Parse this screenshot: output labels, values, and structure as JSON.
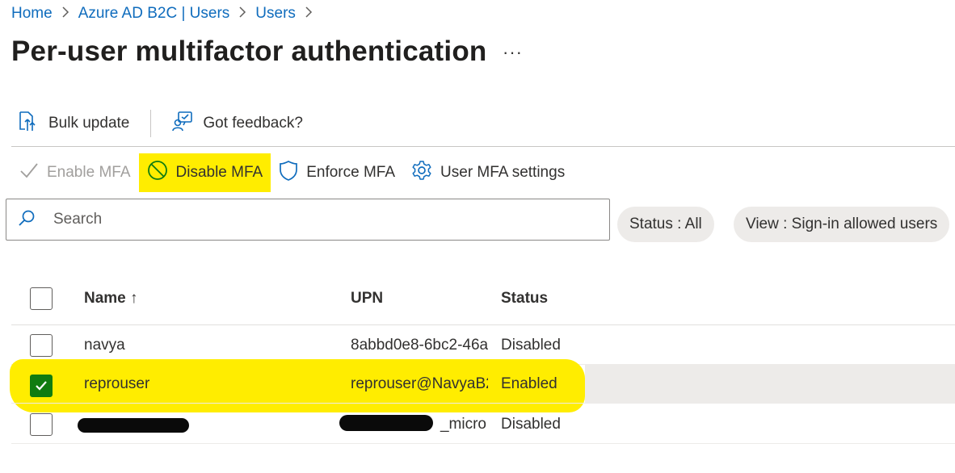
{
  "breadcrumb": {
    "items": [
      "Home",
      "Azure AD B2C | Users",
      "Users"
    ],
    "separator": ">"
  },
  "page": {
    "title": "Per-user multifactor authentication",
    "more_label": "···"
  },
  "toolbar_top": {
    "bulk_update": "Bulk update",
    "feedback": "Got feedback?"
  },
  "toolbar_actions": {
    "enable_mfa": "Enable MFA",
    "disable_mfa": "Disable MFA",
    "enforce_mfa": "Enforce MFA",
    "user_mfa_settings": "User MFA settings"
  },
  "search": {
    "placeholder": "Search",
    "value": ""
  },
  "filters": {
    "status": "Status : All",
    "view": "View : Sign-in allowed users"
  },
  "table": {
    "columns": [
      "Name ↑",
      "UPN",
      "Status"
    ],
    "rows": [
      {
        "name": "navya",
        "upn": "8abbd0e8-6bc2-46a",
        "status": "Disabled",
        "selected": false
      },
      {
        "name": "reprouser",
        "upn": "reprouser@NavyaB2",
        "status": "Enabled",
        "selected": true
      },
      {
        "name": "",
        "upn": "_micro",
        "status": "Disabled",
        "selected": false
      }
    ]
  },
  "colors": {
    "link": "#0f6cbd",
    "highlight": "#ffed00",
    "checkbox_checked": "#107c10"
  },
  "icons": [
    "chevron-right-icon",
    "bulk-update-icon",
    "feedback-icon",
    "checkmark-icon",
    "block-icon",
    "shield-icon",
    "gear-icon",
    "search-icon"
  ]
}
